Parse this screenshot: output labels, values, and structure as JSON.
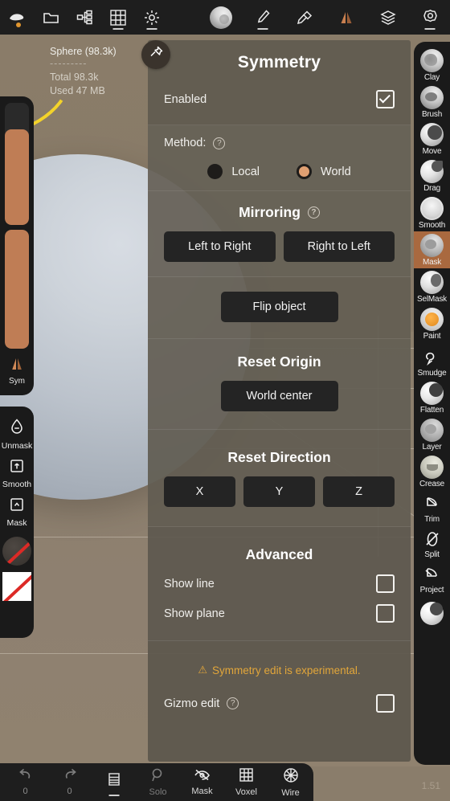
{
  "app": {
    "version": "1.51"
  },
  "topbar": {
    "items": [
      {
        "name": "object-icon",
        "label": ""
      },
      {
        "name": "folder-icon",
        "label": ""
      },
      {
        "name": "scene-tree-icon",
        "label": ""
      },
      {
        "name": "grid-icon",
        "label": ""
      },
      {
        "name": "light-icon",
        "label": ""
      },
      {
        "name": "material-sphere-icon",
        "label": ""
      },
      {
        "name": "brush-icon",
        "label": ""
      },
      {
        "name": "paint-icon",
        "label": ""
      },
      {
        "name": "symmetry-icon",
        "label": ""
      },
      {
        "name": "layers-icon",
        "label": ""
      },
      {
        "name": "settings-icon",
        "label": ""
      },
      {
        "name": "tools-icon",
        "label": ""
      }
    ]
  },
  "stats": {
    "object": "Sphere (98.3k)",
    "divider": "---------",
    "total": "Total 98.3k",
    "used": "Used 47 MB"
  },
  "left_sidebar": {
    "slider_top": {
      "name": "radius-slider",
      "value": 78
    },
    "slider_bottom": {
      "name": "intensity-slider",
      "value": 100
    },
    "sym_label": "Sym",
    "tools": [
      {
        "label": "Unmask",
        "icon": "unmask-drop-icon"
      },
      {
        "label": "Smooth",
        "icon": "smooth-square-icon"
      },
      {
        "label": "Mask",
        "icon": "mask-square-icon"
      }
    ],
    "swatches": [
      {
        "name": "alpha-swatch-none",
        "label": ""
      },
      {
        "name": "texture-swatch-none",
        "label": ""
      }
    ]
  },
  "right_sidebar": {
    "active": "Mask",
    "tools": [
      {
        "label": "Clay",
        "icon": "clay-brush-icon"
      },
      {
        "label": "Brush",
        "icon": "standard-brush-icon"
      },
      {
        "label": "Move",
        "icon": "move-brush-icon"
      },
      {
        "label": "Drag",
        "icon": "drag-brush-icon"
      },
      {
        "label": "Smooth",
        "icon": "smooth-brush-icon"
      },
      {
        "label": "Mask",
        "icon": "mask-brush-icon"
      },
      {
        "label": "SelMask",
        "icon": "selmask-brush-icon"
      },
      {
        "label": "Paint",
        "icon": "paint-brush-icon"
      },
      {
        "label": "Smudge",
        "icon": "smudge-brush-icon"
      },
      {
        "label": "Flatten",
        "icon": "flatten-brush-icon"
      },
      {
        "label": "Layer",
        "icon": "layer-brush-icon"
      },
      {
        "label": "Crease",
        "icon": "crease-brush-icon"
      },
      {
        "label": "Trim",
        "icon": "trim-brush-icon"
      },
      {
        "label": "Split",
        "icon": "split-brush-icon"
      },
      {
        "label": "Project",
        "icon": "project-brush-icon"
      }
    ]
  },
  "panel": {
    "pin_icon": "pin-icon",
    "title": "Symmetry",
    "enabled": {
      "label": "Enabled",
      "checked": true
    },
    "method": {
      "label": "Method:",
      "help": "?",
      "options": [
        {
          "label": "Local",
          "selected": false
        },
        {
          "label": "World",
          "selected": true
        }
      ]
    },
    "mirroring": {
      "title": "Mirroring",
      "help": "?",
      "buttons": [
        {
          "label": "Left to Right"
        },
        {
          "label": "Right to Left"
        }
      ],
      "flip": "Flip object"
    },
    "reset_origin": {
      "title": "Reset Origin",
      "button": "World center"
    },
    "reset_direction": {
      "title": "Reset Direction",
      "buttons": [
        "X",
        "Y",
        "Z"
      ]
    },
    "advanced": {
      "title": "Advanced",
      "rows": [
        {
          "label": "Show line",
          "checked": false
        },
        {
          "label": "Show plane",
          "checked": false
        }
      ],
      "warning_icon": "⚠",
      "warning": "Symmetry edit is experimental.",
      "gizmo": {
        "label": "Gizmo edit",
        "help": "?",
        "checked": false
      }
    }
  },
  "bottombar": {
    "undo": {
      "label": "",
      "count": "0",
      "icon": "undo-icon"
    },
    "redo": {
      "label": "",
      "count": "0",
      "icon": "redo-icon"
    },
    "layers": {
      "label": "",
      "icon": "layers-list-icon"
    },
    "items": [
      {
        "label": "Solo",
        "icon": "solo-icon",
        "active": false
      },
      {
        "label": "Mask",
        "icon": "mask-eye-off-icon",
        "active": true
      },
      {
        "label": "Voxel",
        "icon": "voxel-grid-icon",
        "active": true
      },
      {
        "label": "Wire",
        "icon": "wireframe-icon",
        "active": true
      }
    ]
  },
  "colors": {
    "accent_orange": "#bf7d55",
    "panel_bg": "#5c574c",
    "warn": "#e2a63a",
    "toolbar_bg": "#1e1e1e"
  }
}
